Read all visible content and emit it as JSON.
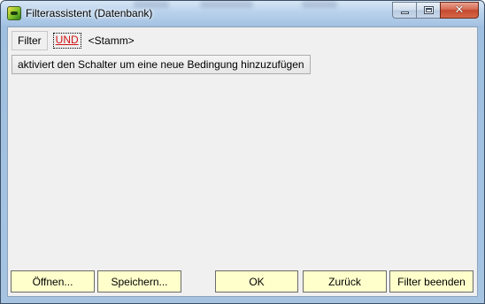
{
  "window": {
    "title": "Filterassistent (Datenbank)",
    "icon": "app-database-icon"
  },
  "window_controls": {
    "minimize": "minimize-icon",
    "maximize": "maximize-icon",
    "close": "close-icon",
    "close_glyph": "✕"
  },
  "toolbar": {
    "filter_label": "Filter",
    "operator_link": "UND",
    "operator_color": "#d01414",
    "stamm_text": "<Stamm>"
  },
  "hint_button": {
    "label": "aktiviert den Schalter um eine neue Bedingung hinzuzufügen"
  },
  "footer": {
    "open_label": "Öffnen...",
    "save_label": "Speichern...",
    "ok_label": "OK",
    "back_label": "Zurück",
    "end_label": "Filter beenden",
    "button_color": "#ffffcc"
  }
}
